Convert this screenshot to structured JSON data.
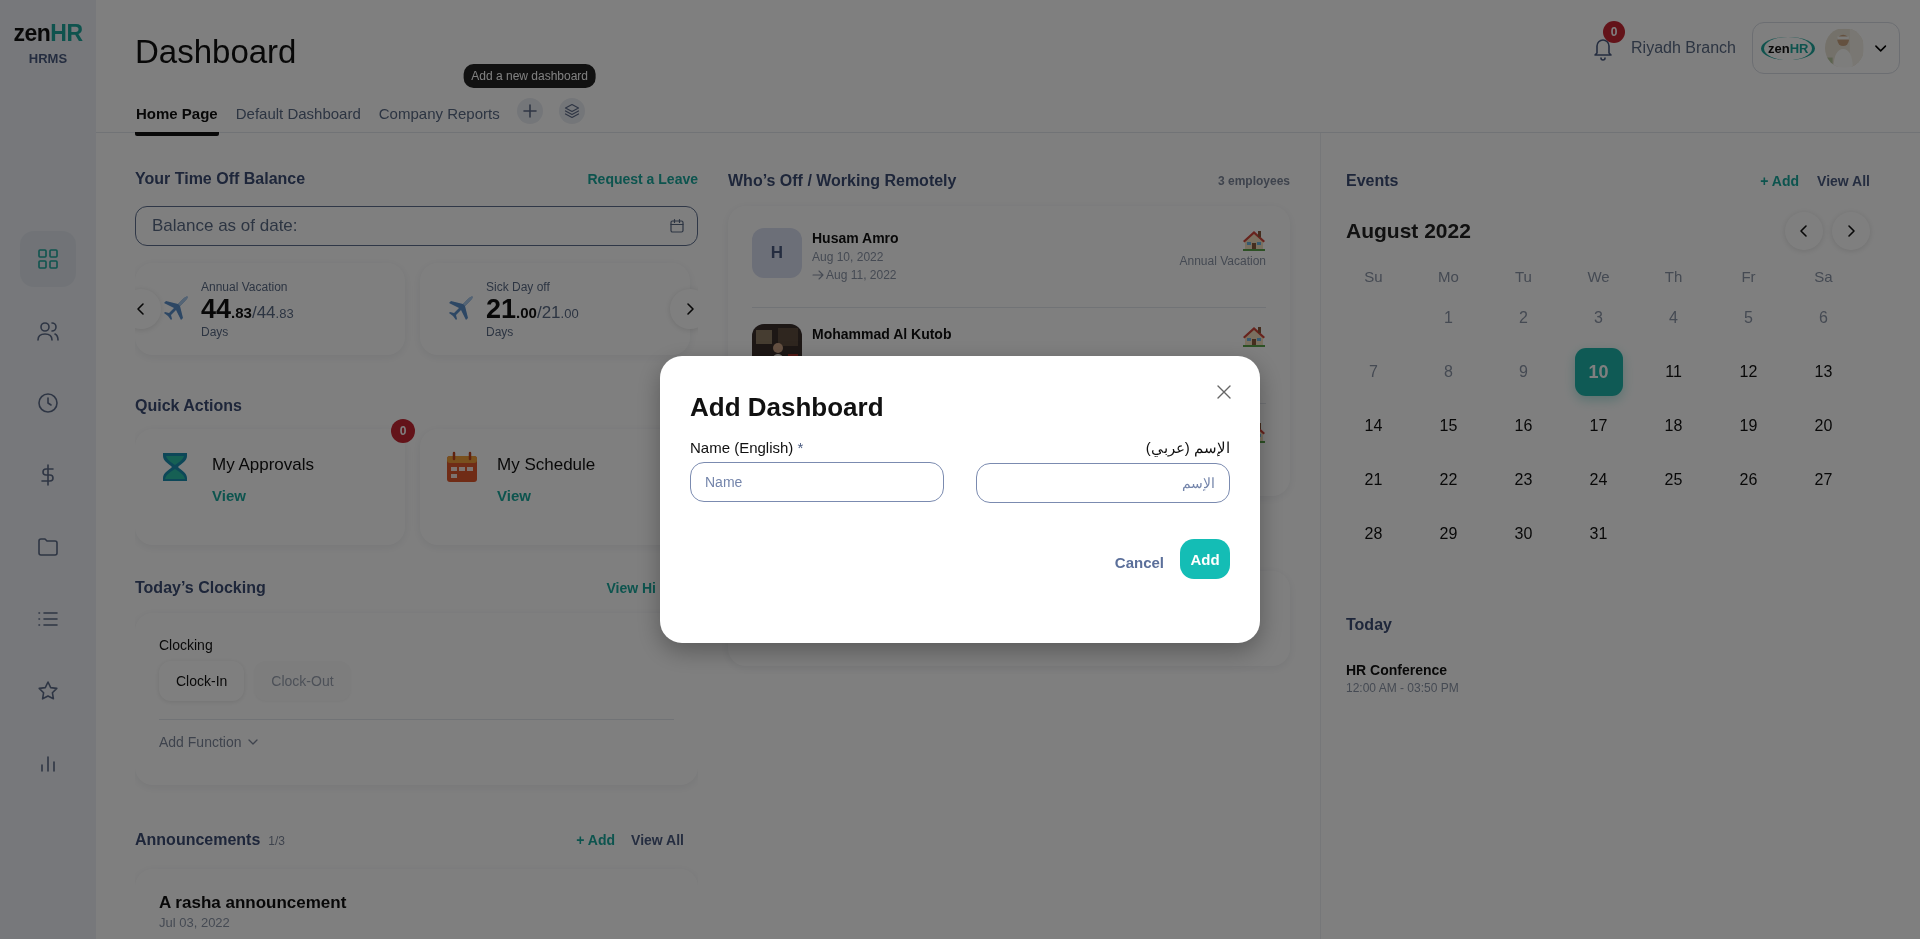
{
  "sidebar": {
    "logo": {
      "brand": "zen",
      "brand_accent": "HR",
      "product": "HRMS"
    },
    "items": [
      {
        "selected": true
      },
      {
        "selected": false
      },
      {
        "selected": false
      },
      {
        "selected": false
      },
      {
        "selected": false
      },
      {
        "selected": false
      },
      {
        "selected": false
      },
      {
        "selected": false
      }
    ]
  },
  "header": {
    "title": "Dashboard",
    "tabs": [
      {
        "label": "Home Page",
        "selected": true
      },
      {
        "label": "Default Dashboard",
        "selected": false
      },
      {
        "label": "Company Reports",
        "selected": false
      }
    ],
    "tooltip": "Add a new dashboard",
    "notification_count": "0",
    "branch": "Riyadh Branch",
    "account_logo": {
      "brand": "zen",
      "brand_accent": "HR"
    }
  },
  "time_off": {
    "title": "Your Time Off Balance",
    "action": "Request a Leave",
    "date_field": {
      "placeholder": "Balance as of date:"
    },
    "balances": [
      {
        "type": "Annual Vacation",
        "amount": "44",
        "amount_decimals": ".83",
        "total": "/44",
        "total_decimals": ".83",
        "unit": "Days"
      },
      {
        "type": "Sick Day off",
        "amount": "21",
        "amount_decimals": ".00",
        "total": "/21",
        "total_decimals": ".00",
        "unit": "Days"
      }
    ]
  },
  "quick_actions": {
    "title": "Quick Actions",
    "items": [
      {
        "title": "My Approvals",
        "link": "View",
        "badge": "0"
      },
      {
        "title": "My Schedule",
        "link": "View"
      }
    ]
  },
  "clocking": {
    "title": "Today’s Clocking",
    "action": "View Hi",
    "label": "Clocking",
    "buttons": [
      {
        "label": "Clock-In",
        "disabled": false
      },
      {
        "label": "Clock-Out",
        "disabled": true
      }
    ],
    "add_function": "Add Function"
  },
  "announcements": {
    "title": "Announcements",
    "count": "1/3",
    "add": "+ Add",
    "view_all": "View All",
    "items": [
      {
        "title": "A rasha announcement",
        "date": "Jul 03, 2022"
      }
    ]
  },
  "whos_off": {
    "title": "Who’s Off / Working Remotely",
    "count": "3 employees",
    "people": [
      {
        "kind": "initial",
        "initial": "H",
        "name": "Husam Amro",
        "date": "Aug 10, 2022",
        "until": "Aug 11, 2022",
        "leave": "Annual Vacation"
      },
      {
        "name": "Mohammad Al Kutob"
      },
      {
        "kind": "blank"
      }
    ]
  },
  "events": {
    "title": "Events",
    "add": "+ Add",
    "view_all": "View All",
    "month": "August 2022",
    "weekdays": [
      "Su",
      "Mo",
      "Tu",
      "We",
      "Th",
      "Fr",
      "Sa"
    ],
    "weeks": [
      [
        {
          "kind": "blank"
        },
        {
          "kind": "day",
          "label": "1",
          "muted": true,
          "selected": false
        },
        {
          "kind": "day",
          "label": "2",
          "muted": true,
          "selected": false
        },
        {
          "kind": "day",
          "label": "3",
          "muted": true,
          "selected": false
        },
        {
          "kind": "day",
          "label": "4",
          "muted": true,
          "selected": false
        },
        {
          "kind": "day",
          "label": "5",
          "muted": true,
          "selected": false
        },
        {
          "kind": "day",
          "label": "6",
          "muted": true,
          "selected": false
        }
      ],
      [
        {
          "kind": "day",
          "label": "7",
          "muted": true,
          "selected": false
        },
        {
          "kind": "day",
          "label": "8",
          "muted": true,
          "selected": false
        },
        {
          "kind": "day",
          "label": "9",
          "muted": true,
          "selected": false
        },
        {
          "kind": "day",
          "label": "10",
          "muted": false,
          "selected": true
        },
        {
          "kind": "day",
          "label": "11",
          "muted": false,
          "selected": false
        },
        {
          "kind": "day",
          "label": "12",
          "muted": false,
          "selected": false
        },
        {
          "kind": "day",
          "label": "13",
          "muted": false,
          "selected": false
        }
      ],
      [
        {
          "kind": "day",
          "label": "14",
          "muted": false,
          "selected": false
        },
        {
          "kind": "day",
          "label": "15",
          "muted": false,
          "selected": false
        },
        {
          "kind": "day",
          "label": "16",
          "muted": false,
          "selected": false
        },
        {
          "kind": "day",
          "label": "17",
          "muted": false,
          "selected": false
        },
        {
          "kind": "day",
          "label": "18",
          "muted": false,
          "selected": false
        },
        {
          "kind": "day",
          "label": "19",
          "muted": false,
          "selected": false
        },
        {
          "kind": "day",
          "label": "20",
          "muted": false,
          "selected": false
        }
      ],
      [
        {
          "kind": "day",
          "label": "21",
          "muted": false,
          "selected": false
        },
        {
          "kind": "day",
          "label": "22",
          "muted": false,
          "selected": false
        },
        {
          "kind": "day",
          "label": "23",
          "muted": false,
          "selected": false
        },
        {
          "kind": "day",
          "label": "24",
          "muted": false,
          "selected": false
        },
        {
          "kind": "day",
          "label": "25",
          "muted": false,
          "selected": false
        },
        {
          "kind": "day",
          "label": "26",
          "muted": false,
          "selected": false
        },
        {
          "kind": "day",
          "label": "27",
          "muted": false,
          "selected": false
        }
      ],
      [
        {
          "kind": "day",
          "label": "28",
          "muted": false,
          "selected": false
        },
        {
          "kind": "day",
          "label": "29",
          "muted": false,
          "selected": false
        },
        {
          "kind": "day",
          "label": "30",
          "muted": false,
          "selected": false
        },
        {
          "kind": "day",
          "label": "31",
          "muted": false,
          "selected": false
        },
        {
          "kind": "blank"
        },
        {
          "kind": "blank"
        },
        {
          "kind": "blank"
        }
      ]
    ]
  },
  "today": {
    "title": "Today",
    "items": [
      {
        "title": "HR Conference",
        "time": "12:00 AM - 03:50 PM"
      }
    ]
  },
  "modal": {
    "title": "Add Dashboard",
    "fields": [
      {
        "label": "Name (English)",
        "required_mark": "*",
        "placeholder": "Name",
        "kind": "english"
      },
      {
        "label": "الإسم (عربي)",
        "placeholder": "الإسم",
        "kind": "arabic"
      }
    ],
    "cancel": "Cancel",
    "submit": "Add"
  }
}
